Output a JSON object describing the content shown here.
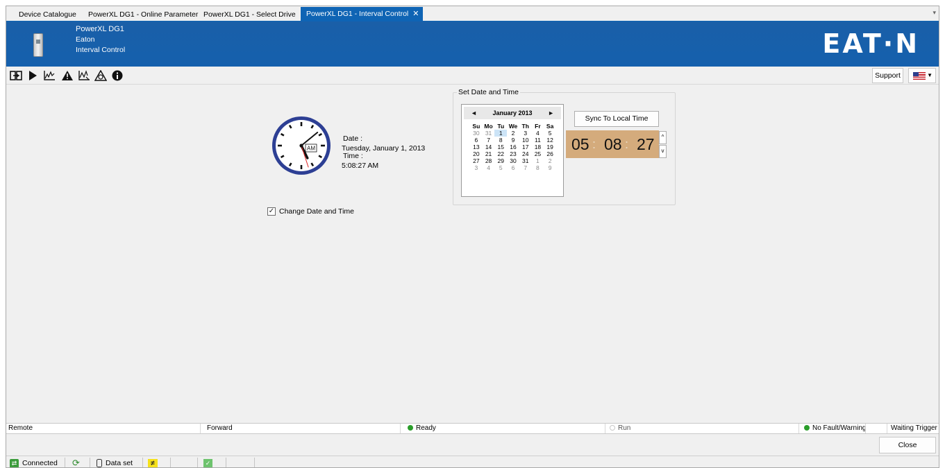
{
  "tabs": [
    {
      "label": "Device Catalogue"
    },
    {
      "label": "PowerXL DG1 - Online Parameter"
    },
    {
      "label": "PowerXL DG1 - Select Drive"
    },
    {
      "label": "PowerXL DG1 - Interval Control",
      "active": true
    }
  ],
  "tab_close_glyph": "✕",
  "tab_menu_glyph": "▾",
  "banner": {
    "device_name": "PowerXL DG1",
    "manufacturer": "Eaton",
    "page_name": "Interval Control",
    "logo_text": "EAT·N",
    "background_color": "#1560ad"
  },
  "toolbar": {
    "icons": [
      "connect-icon",
      "play-icon",
      "trend-icon",
      "warning-icon",
      "scope-icon",
      "fault-history-icon",
      "info-icon"
    ],
    "support_label": "Support",
    "language_flag": "us-flag-icon"
  },
  "clock": {
    "am_pm": "AM",
    "date_label": "Date :",
    "date_value": "Tuesday, January 1, 2013",
    "time_label": "Time :",
    "time_value": "5:08:27 AM",
    "hour": 5,
    "minute": 8,
    "second": 27
  },
  "change_date_time": {
    "label": "Change Date and Time",
    "checked": true
  },
  "set_date_time": {
    "legend": "Set Date and Time",
    "calendar": {
      "month_label": "January 2013",
      "prev_glyph": "◄",
      "next_glyph": "►",
      "weekdays": [
        "Su",
        "Mo",
        "Tu",
        "We",
        "Th",
        "Fr",
        "Sa"
      ],
      "weeks": [
        [
          "30",
          "31",
          "1",
          "2",
          "3",
          "4",
          "5"
        ],
        [
          "6",
          "7",
          "8",
          "9",
          "10",
          "11",
          "12"
        ],
        [
          "13",
          "14",
          "15",
          "16",
          "17",
          "18",
          "19"
        ],
        [
          "20",
          "21",
          "22",
          "23",
          "24",
          "25",
          "26"
        ],
        [
          "27",
          "28",
          "29",
          "30",
          "31",
          "1",
          "2"
        ],
        [
          "3",
          "4",
          "5",
          "6",
          "7",
          "8",
          "9"
        ]
      ],
      "selected_day": "1"
    },
    "sync_label": "Sync To Local Time",
    "time": {
      "hh": "05",
      "mm": "08",
      "ss": "27",
      "separator": ":"
    },
    "spin_up": "^",
    "spin_down": "v",
    "time_background": "#d4ab7c"
  },
  "status": {
    "control_place": "Remote",
    "direction": "Forward",
    "ready": "Ready",
    "run": "Run",
    "fault": "No Fault/Warning",
    "trigger": "Waiting Trigger",
    "ok_color": "#2a9d2a"
  },
  "close_label": "Close",
  "statusbar": {
    "connected": "Connected",
    "dataset": "Data set"
  }
}
